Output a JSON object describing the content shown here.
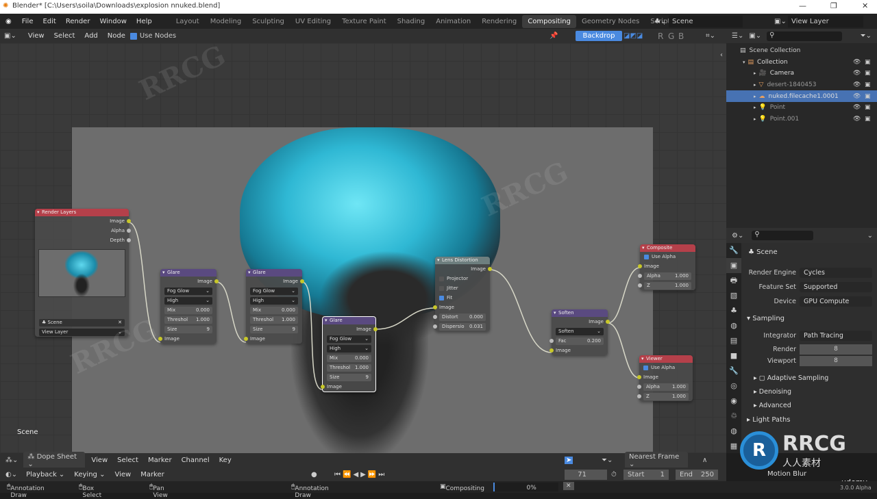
{
  "window": {
    "title": "Blender* [C:\\Users\\soila\\Downloads\\explosion nnuked.blend]",
    "min": "—",
    "max": "❐",
    "close": "✕"
  },
  "menu": [
    "File",
    "Edit",
    "Render",
    "Window",
    "Help"
  ],
  "workspaces": [
    "Layout",
    "Modeling",
    "Sculpting",
    "UV Editing",
    "Texture Paint",
    "Shading",
    "Animation",
    "Rendering",
    "Compositing",
    "Geometry Nodes",
    "Scripting",
    "+"
  ],
  "active_workspace": "Compositing",
  "scene": "Scene",
  "view_layer": "View Layer",
  "node_header": {
    "items": [
      "View",
      "Select",
      "Add",
      "Node"
    ],
    "use_nodes": "Use Nodes",
    "backdrop": "Backdrop",
    "channels": [
      "R",
      "G",
      "B"
    ]
  },
  "nodes": [
    {
      "id": "render-layers",
      "title": "Render Layers",
      "color": "#b5404a",
      "rows": [
        {
          "t": "out",
          "l": "Image"
        },
        {
          "t": "out",
          "l": "Alpha",
          "g": 1
        },
        {
          "t": "out",
          "l": "Depth",
          "g": 1
        }
      ],
      "scene": "Scene",
      "layer": "View Layer"
    },
    {
      "id": "glare-1",
      "title": "Glare",
      "color": "#5a4a80",
      "rows": [
        {
          "t": "out",
          "l": "Image"
        },
        {
          "t": "sel",
          "v": "Fog Glow"
        },
        {
          "t": "sel",
          "v": "High"
        },
        {
          "t": "fld",
          "l": "Mix",
          "v": "0.000"
        },
        {
          "t": "fld",
          "l": "Threshol",
          "v": "1.000"
        },
        {
          "t": "fld",
          "l": "Size",
          "v": "9"
        },
        {
          "t": "in",
          "l": "Image"
        }
      ]
    },
    {
      "id": "glare-2",
      "title": "Glare",
      "color": "#5a4a80",
      "rows": [
        {
          "t": "out",
          "l": "Image"
        },
        {
          "t": "sel",
          "v": "Fog Glow"
        },
        {
          "t": "sel",
          "v": "High"
        },
        {
          "t": "fld",
          "l": "Mix",
          "v": "0.000"
        },
        {
          "t": "fld",
          "l": "Threshol",
          "v": "1.000"
        },
        {
          "t": "fld",
          "l": "Size",
          "v": "9"
        },
        {
          "t": "in",
          "l": "Image"
        }
      ]
    },
    {
      "id": "glare-3",
      "title": "Glare",
      "color": "#5a4a80",
      "selected": true,
      "rows": [
        {
          "t": "out",
          "l": "Image"
        },
        {
          "t": "sel",
          "v": "Fog Glow"
        },
        {
          "t": "sel",
          "v": "High"
        },
        {
          "t": "fld",
          "l": "Mix",
          "v": "0.000"
        },
        {
          "t": "fld",
          "l": "Threshol",
          "v": "1.000"
        },
        {
          "t": "fld",
          "l": "Size",
          "v": "9"
        },
        {
          "t": "in",
          "l": "Image"
        }
      ]
    },
    {
      "id": "lens-distortion",
      "title": "Lens Distortion",
      "color": "#6e7f7f",
      "rows": [
        {
          "t": "out",
          "l": "Image"
        },
        {
          "t": "chk",
          "l": "Projector",
          "c": false
        },
        {
          "t": "chk",
          "l": "Jitter",
          "c": false
        },
        {
          "t": "chk",
          "l": "Fit",
          "c": true
        },
        {
          "t": "in",
          "l": "Image"
        },
        {
          "t": "fld",
          "l": "Distort",
          "v": "0.000",
          "s": 1
        },
        {
          "t": "fld",
          "l": "Dispersio",
          "v": "0.031",
          "s": 1
        }
      ]
    },
    {
      "id": "soften",
      "title": "Soften",
      "color": "#5a4a80",
      "rows": [
        {
          "t": "out",
          "l": "Image"
        },
        {
          "t": "sel",
          "v": "Soften"
        },
        {
          "t": "fld",
          "l": "Fac",
          "v": "0.200",
          "s": 1
        },
        {
          "t": "in",
          "l": "Image"
        }
      ]
    },
    {
      "id": "composite",
      "title": "Composite",
      "color": "#b5404a",
      "rows": [
        {
          "t": "chk",
          "l": "Use Alpha",
          "c": true
        },
        {
          "t": "in",
          "l": "Image"
        },
        {
          "t": "fld",
          "l": "Alpha",
          "v": "1.000",
          "s": 1
        },
        {
          "t": "fld",
          "l": "Z",
          "v": "1.000",
          "s": 1
        }
      ]
    },
    {
      "id": "viewer",
      "title": "Viewer",
      "color": "#b5404a",
      "rows": [
        {
          "t": "chk",
          "l": "Use Alpha",
          "c": true
        },
        {
          "t": "in",
          "l": "Image"
        },
        {
          "t": "fld",
          "l": "Alpha",
          "v": "1.000",
          "s": 1
        },
        {
          "t": "fld",
          "l": "Z",
          "v": "1.000",
          "s": 1
        }
      ]
    }
  ],
  "editor_label": "Scene",
  "outliner": {
    "root": "Scene Collection",
    "items": [
      {
        "name": "Collection",
        "icon": "collection-icon"
      },
      {
        "name": "Camera",
        "icon": "camera-icon"
      },
      {
        "name": "desert-1840453",
        "icon": "mesh-icon"
      },
      {
        "name": "nuked.filecache1.0001",
        "icon": "volume-icon",
        "selected": true
      },
      {
        "name": "Point",
        "icon": "light-icon"
      },
      {
        "name": "Point.001",
        "icon": "light-icon"
      }
    ]
  },
  "properties": {
    "context": "Scene",
    "render_engine_label": "Render Engine",
    "render_engine": "Cycles",
    "feature_set_label": "Feature Set",
    "feature_set": "Supported",
    "device_label": "Device",
    "device": "GPU Compute",
    "sampling": "Sampling",
    "integrator_label": "Integrator",
    "integrator": "Path Tracing",
    "render_label": "Render",
    "render": "8",
    "viewport_label": "Viewport",
    "viewport": "8",
    "subpanels": [
      "Adaptive Sampling",
      "Denoising",
      "Advanced"
    ],
    "light_paths": "Light Paths",
    "motion_blur": "Motion Blur"
  },
  "dope": {
    "editor": "Dope Sheet",
    "items": [
      "View",
      "Select",
      "Marker",
      "Channel",
      "Key"
    ],
    "snap": "Nearest Frame"
  },
  "timeline": {
    "items": [
      "Playback",
      "Keying",
      "View",
      "Marker"
    ],
    "frame": "71",
    "start_label": "Start",
    "start": "1",
    "end_label": "End",
    "end": "250"
  },
  "status": {
    "a": "Annotation Draw",
    "b": "Box Select",
    "c": "Pan View",
    "d": "Annotation Draw",
    "job": "Compositing",
    "progress": "0%",
    "progress_value": 0,
    "version": "3.0.0 Alpha"
  },
  "watermark": [
    "RRCG",
    "人人素材",
    "udemy"
  ],
  "colors": {
    "accent": "#4a8ae0",
    "selection": "#4772b3",
    "node_output": "#b5404a",
    "node_filter": "#5a4a80",
    "smoke_cyan": "#3fc8e0"
  }
}
